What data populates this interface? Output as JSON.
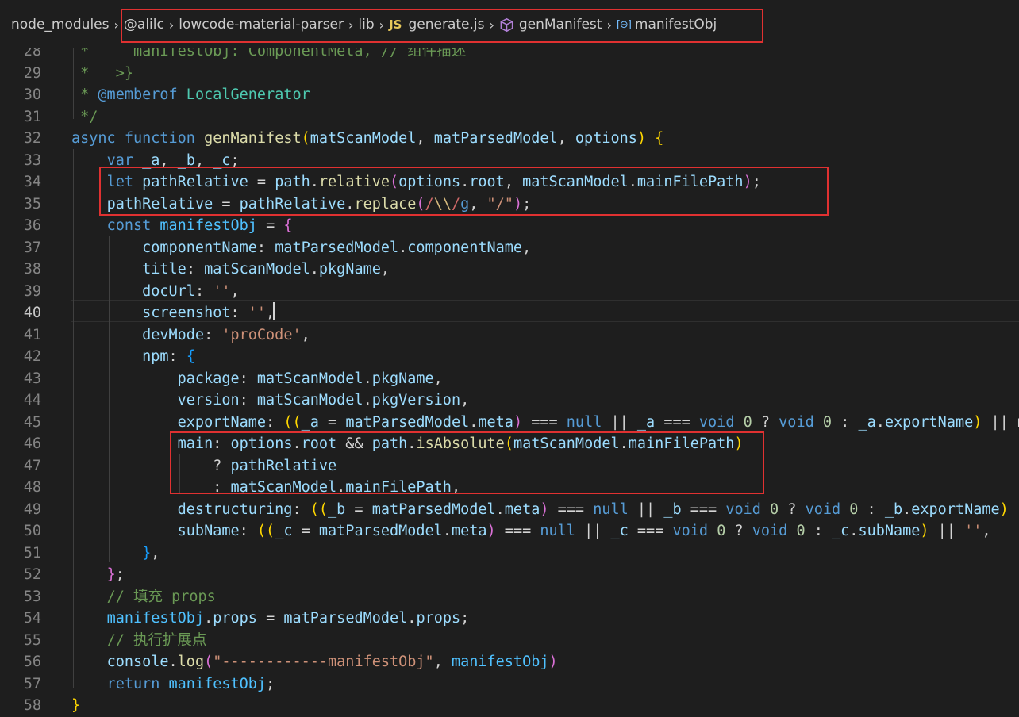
{
  "breadcrumb": {
    "items": [
      "node_modules",
      "@alilc",
      "lowcode-material-parser",
      "lib",
      "generate.js",
      "genManifest",
      "manifestObj"
    ],
    "file_badge": "JS"
  },
  "editor": {
    "active_line": 40,
    "lines": [
      {
        "n": "28",
        "tokens": [
          [
            "c-cm",
            " *     "
          ],
          [
            "c-cm",
            "manifestObj: ComponentMeta, // 组件描述"
          ]
        ]
      },
      {
        "n": "29",
        "tokens": [
          [
            "c-cm",
            " *   >}"
          ]
        ]
      },
      {
        "n": "30",
        "tokens": [
          [
            "c-cm",
            " * "
          ],
          [
            "c-tag",
            "@memberof"
          ],
          [
            "c-type",
            " LocalGenerator"
          ]
        ]
      },
      {
        "n": "31",
        "tokens": [
          [
            "c-cm",
            " */"
          ]
        ]
      },
      {
        "n": "32",
        "tokens": [
          [
            "c-kw",
            "async"
          ],
          [
            "c-pl",
            " "
          ],
          [
            "c-kw",
            "function"
          ],
          [
            "c-pl",
            " "
          ],
          [
            "c-fn",
            "genManifest"
          ],
          [
            "c-br",
            "("
          ],
          [
            "c-var",
            "matScanModel"
          ],
          [
            "c-pl",
            ", "
          ],
          [
            "c-var",
            "matParsedModel"
          ],
          [
            "c-pl",
            ", "
          ],
          [
            "c-var",
            "options"
          ],
          [
            "c-br",
            ")"
          ],
          [
            "c-pl",
            " "
          ],
          [
            "c-br",
            "{"
          ]
        ]
      },
      {
        "n": "33",
        "tokens": [
          [
            "c-pl",
            "    "
          ],
          [
            "c-kw",
            "var"
          ],
          [
            "c-pl",
            " "
          ],
          [
            "c-var",
            "_a"
          ],
          [
            "c-pl",
            ", "
          ],
          [
            "c-var",
            "_b"
          ],
          [
            "c-pl",
            ", "
          ],
          [
            "c-var",
            "_c"
          ],
          [
            "c-pl",
            ";"
          ]
        ]
      },
      {
        "n": "34",
        "tokens": [
          [
            "c-pl",
            "    "
          ],
          [
            "c-kw",
            "let"
          ],
          [
            "c-pl",
            " "
          ],
          [
            "c-var",
            "pathRelative"
          ],
          [
            "c-pl",
            " = "
          ],
          [
            "c-var",
            "path"
          ],
          [
            "c-pl",
            "."
          ],
          [
            "c-fn",
            "relative"
          ],
          [
            "c-br2",
            "("
          ],
          [
            "c-var",
            "options"
          ],
          [
            "c-pl",
            "."
          ],
          [
            "c-var",
            "root"
          ],
          [
            "c-pl",
            ", "
          ],
          [
            "c-var",
            "matScanModel"
          ],
          [
            "c-pl",
            "."
          ],
          [
            "c-var",
            "mainFilePath"
          ],
          [
            "c-br2",
            ")"
          ],
          [
            "c-pl",
            ";"
          ]
        ]
      },
      {
        "n": "35",
        "tokens": [
          [
            "c-pl",
            "    "
          ],
          [
            "c-var",
            "pathRelative"
          ],
          [
            "c-pl",
            " = "
          ],
          [
            "c-var",
            "pathRelative"
          ],
          [
            "c-pl",
            "."
          ],
          [
            "c-fn",
            "replace"
          ],
          [
            "c-br2",
            "("
          ],
          [
            "c-rx",
            "/"
          ],
          [
            "c-rxc",
            "\\\\"
          ],
          [
            "c-rx",
            "/"
          ],
          [
            "c-kw",
            "g"
          ],
          [
            "c-pl",
            ", "
          ],
          [
            "c-str",
            "\"/\""
          ],
          [
            "c-br2",
            ")"
          ],
          [
            "c-pl",
            ";"
          ]
        ]
      },
      {
        "n": "36",
        "tokens": [
          [
            "c-pl",
            "    "
          ],
          [
            "c-kw",
            "const"
          ],
          [
            "c-pl",
            " "
          ],
          [
            "c-const",
            "manifestObj"
          ],
          [
            "c-pl",
            " = "
          ],
          [
            "c-br2",
            "{"
          ]
        ]
      },
      {
        "n": "37",
        "tokens": [
          [
            "c-pl",
            "        "
          ],
          [
            "c-var",
            "componentName"
          ],
          [
            "c-pl",
            ": "
          ],
          [
            "c-var",
            "matParsedModel"
          ],
          [
            "c-pl",
            "."
          ],
          [
            "c-var",
            "componentName"
          ],
          [
            "c-pl",
            ","
          ]
        ]
      },
      {
        "n": "38",
        "tokens": [
          [
            "c-pl",
            "        "
          ],
          [
            "c-var",
            "title"
          ],
          [
            "c-pl",
            ": "
          ],
          [
            "c-var",
            "matScanModel"
          ],
          [
            "c-pl",
            "."
          ],
          [
            "c-var",
            "pkgName"
          ],
          [
            "c-pl",
            ","
          ]
        ]
      },
      {
        "n": "39",
        "tokens": [
          [
            "c-pl",
            "        "
          ],
          [
            "c-var",
            "docUrl"
          ],
          [
            "c-pl",
            ": "
          ],
          [
            "c-str",
            "''"
          ],
          [
            "c-pl",
            ","
          ]
        ]
      },
      {
        "n": "40",
        "tokens": [
          [
            "c-pl",
            "        "
          ],
          [
            "c-var",
            "screenshot"
          ],
          [
            "c-pl",
            ": "
          ],
          [
            "c-str",
            "''"
          ],
          [
            "c-pl",
            ","
          ]
        ]
      },
      {
        "n": "41",
        "tokens": [
          [
            "c-pl",
            "        "
          ],
          [
            "c-var",
            "devMode"
          ],
          [
            "c-pl",
            ": "
          ],
          [
            "c-str",
            "'proCode'"
          ],
          [
            "c-pl",
            ","
          ]
        ]
      },
      {
        "n": "42",
        "tokens": [
          [
            "c-pl",
            "        "
          ],
          [
            "c-var",
            "npm"
          ],
          [
            "c-pl",
            ": "
          ],
          [
            "c-br3",
            "{"
          ]
        ]
      },
      {
        "n": "43",
        "tokens": [
          [
            "c-pl",
            "            "
          ],
          [
            "c-var",
            "package"
          ],
          [
            "c-pl",
            ": "
          ],
          [
            "c-var",
            "matScanModel"
          ],
          [
            "c-pl",
            "."
          ],
          [
            "c-var",
            "pkgName"
          ],
          [
            "c-pl",
            ","
          ]
        ]
      },
      {
        "n": "44",
        "tokens": [
          [
            "c-pl",
            "            "
          ],
          [
            "c-var",
            "version"
          ],
          [
            "c-pl",
            ": "
          ],
          [
            "c-var",
            "matScanModel"
          ],
          [
            "c-pl",
            "."
          ],
          [
            "c-var",
            "pkgVersion"
          ],
          [
            "c-pl",
            ","
          ]
        ]
      },
      {
        "n": "45",
        "tokens": [
          [
            "c-pl",
            "            "
          ],
          [
            "c-var",
            "exportName"
          ],
          [
            "c-pl",
            ": "
          ],
          [
            "c-br",
            "(("
          ],
          [
            "c-var",
            "_a"
          ],
          [
            "c-pl",
            " = "
          ],
          [
            "c-var",
            "matParsedModel"
          ],
          [
            "c-pl",
            "."
          ],
          [
            "c-var",
            "meta"
          ],
          [
            "c-br2",
            ")"
          ],
          [
            "c-pl",
            " === "
          ],
          [
            "c-kw",
            "null"
          ],
          [
            "c-pl",
            " || "
          ],
          [
            "c-var",
            "_a"
          ],
          [
            "c-pl",
            " === "
          ],
          [
            "c-kw",
            "void"
          ],
          [
            "c-pl",
            " "
          ],
          [
            "c-num",
            "0"
          ],
          [
            "c-pl",
            " ? "
          ],
          [
            "c-kw",
            "void"
          ],
          [
            "c-pl",
            " "
          ],
          [
            "c-num",
            "0"
          ],
          [
            "c-pl",
            " : "
          ],
          [
            "c-var",
            "_a"
          ],
          [
            "c-pl",
            "."
          ],
          [
            "c-var",
            "exportName"
          ],
          [
            "c-br",
            ")"
          ],
          [
            "c-pl",
            " || m"
          ]
        ]
      },
      {
        "n": "46",
        "tokens": [
          [
            "c-pl",
            "            "
          ],
          [
            "c-var",
            "main"
          ],
          [
            "c-pl",
            ": "
          ],
          [
            "c-var",
            "options"
          ],
          [
            "c-pl",
            "."
          ],
          [
            "c-var",
            "root"
          ],
          [
            "c-pl",
            " && "
          ],
          [
            "c-var",
            "path"
          ],
          [
            "c-pl",
            "."
          ],
          [
            "c-fn",
            "isAbsolute"
          ],
          [
            "c-br",
            "("
          ],
          [
            "c-var",
            "matScanModel"
          ],
          [
            "c-pl",
            "."
          ],
          [
            "c-var",
            "mainFilePath"
          ],
          [
            "c-br",
            ")"
          ]
        ]
      },
      {
        "n": "47",
        "tokens": [
          [
            "c-pl",
            "                ? "
          ],
          [
            "c-var",
            "pathRelative"
          ]
        ]
      },
      {
        "n": "48",
        "tokens": [
          [
            "c-pl",
            "                : "
          ],
          [
            "c-var",
            "matScanModel"
          ],
          [
            "c-pl",
            "."
          ],
          [
            "c-var",
            "mainFilePath"
          ],
          [
            "c-pl",
            ","
          ]
        ]
      },
      {
        "n": "49",
        "tokens": [
          [
            "c-pl",
            "            "
          ],
          [
            "c-var",
            "destructuring"
          ],
          [
            "c-pl",
            ": "
          ],
          [
            "c-br",
            "(("
          ],
          [
            "c-var",
            "_b"
          ],
          [
            "c-pl",
            " = "
          ],
          [
            "c-var",
            "matParsedModel"
          ],
          [
            "c-pl",
            "."
          ],
          [
            "c-var",
            "meta"
          ],
          [
            "c-br2",
            ")"
          ],
          [
            "c-pl",
            " === "
          ],
          [
            "c-kw",
            "null"
          ],
          [
            "c-pl",
            " || "
          ],
          [
            "c-var",
            "_b"
          ],
          [
            "c-pl",
            " === "
          ],
          [
            "c-kw",
            "void"
          ],
          [
            "c-pl",
            " "
          ],
          [
            "c-num",
            "0"
          ],
          [
            "c-pl",
            " ? "
          ],
          [
            "c-kw",
            "void"
          ],
          [
            "c-pl",
            " "
          ],
          [
            "c-num",
            "0"
          ],
          [
            "c-pl",
            " : "
          ],
          [
            "c-var",
            "_b"
          ],
          [
            "c-pl",
            "."
          ],
          [
            "c-var",
            "exportName"
          ],
          [
            "c-br",
            ")"
          ],
          [
            "c-pl",
            " !"
          ]
        ]
      },
      {
        "n": "50",
        "tokens": [
          [
            "c-pl",
            "            "
          ],
          [
            "c-var",
            "subName"
          ],
          [
            "c-pl",
            ": "
          ],
          [
            "c-br",
            "(("
          ],
          [
            "c-var",
            "_c"
          ],
          [
            "c-pl",
            " = "
          ],
          [
            "c-var",
            "matParsedModel"
          ],
          [
            "c-pl",
            "."
          ],
          [
            "c-var",
            "meta"
          ],
          [
            "c-br2",
            ")"
          ],
          [
            "c-pl",
            " === "
          ],
          [
            "c-kw",
            "null"
          ],
          [
            "c-pl",
            " || "
          ],
          [
            "c-var",
            "_c"
          ],
          [
            "c-pl",
            " === "
          ],
          [
            "c-kw",
            "void"
          ],
          [
            "c-pl",
            " "
          ],
          [
            "c-num",
            "0"
          ],
          [
            "c-pl",
            " ? "
          ],
          [
            "c-kw",
            "void"
          ],
          [
            "c-pl",
            " "
          ],
          [
            "c-num",
            "0"
          ],
          [
            "c-pl",
            " : "
          ],
          [
            "c-var",
            "_c"
          ],
          [
            "c-pl",
            "."
          ],
          [
            "c-var",
            "subName"
          ],
          [
            "c-br",
            ")"
          ],
          [
            "c-pl",
            " || "
          ],
          [
            "c-str",
            "''"
          ],
          [
            "c-pl",
            ","
          ]
        ]
      },
      {
        "n": "51",
        "tokens": [
          [
            "c-pl",
            "        "
          ],
          [
            "c-br3",
            "}"
          ],
          [
            "c-pl",
            ","
          ]
        ]
      },
      {
        "n": "52",
        "tokens": [
          [
            "c-pl",
            "    "
          ],
          [
            "c-br2",
            "}"
          ],
          [
            "c-pl",
            ";"
          ]
        ]
      },
      {
        "n": "53",
        "tokens": [
          [
            "c-pl",
            "    "
          ],
          [
            "c-cm",
            "// 填充 props"
          ]
        ]
      },
      {
        "n": "54",
        "tokens": [
          [
            "c-pl",
            "    "
          ],
          [
            "c-const",
            "manifestObj"
          ],
          [
            "c-pl",
            "."
          ],
          [
            "c-var",
            "props"
          ],
          [
            "c-pl",
            " = "
          ],
          [
            "c-var",
            "matParsedModel"
          ],
          [
            "c-pl",
            "."
          ],
          [
            "c-var",
            "props"
          ],
          [
            "c-pl",
            ";"
          ]
        ]
      },
      {
        "n": "55",
        "tokens": [
          [
            "c-pl",
            "    "
          ],
          [
            "c-cm",
            "// 执行扩展点"
          ]
        ]
      },
      {
        "n": "56",
        "tokens": [
          [
            "c-pl",
            "    "
          ],
          [
            "c-var",
            "console"
          ],
          [
            "c-pl",
            "."
          ],
          [
            "c-fn",
            "log"
          ],
          [
            "c-br2",
            "("
          ],
          [
            "c-str",
            "\"------------manifestObj\""
          ],
          [
            "c-pl",
            ", "
          ],
          [
            "c-const",
            "manifestObj"
          ],
          [
            "c-br2",
            ")"
          ]
        ]
      },
      {
        "n": "57",
        "tokens": [
          [
            "c-pl",
            "    "
          ],
          [
            "c-kw",
            "return"
          ],
          [
            "c-pl",
            " "
          ],
          [
            "c-const",
            "manifestObj"
          ],
          [
            "c-pl",
            ";"
          ]
        ]
      },
      {
        "n": "58",
        "tokens": [
          [
            "c-br",
            "}"
          ]
        ]
      }
    ]
  }
}
